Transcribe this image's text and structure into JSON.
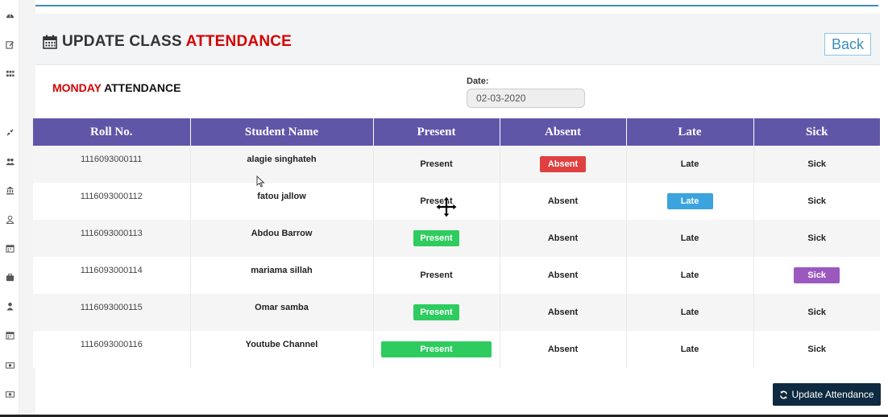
{
  "sidebar": {
    "icons": [
      "dashboard-icon",
      "edit-icon",
      "grid-icon",
      "compress-icon",
      "users-icon",
      "institution-icon",
      "user-outline-icon",
      "calendar-icon",
      "briefcase-icon",
      "user-icon",
      "calendar-icon",
      "money-icon",
      "money-icon"
    ]
  },
  "header": {
    "title_main": "UPDATE CLASS",
    "title_accent": "ATTENDANCE",
    "back_label": "Back",
    "icon": "calendar-icon"
  },
  "attendance": {
    "day": "MONDAY",
    "title_rest": "ATTENDANCE",
    "date_label": "Date:",
    "date_value": "02-03-2020"
  },
  "table": {
    "columns": [
      "Roll No.",
      "Student Name",
      "Present",
      "Absent",
      "Late",
      "Sick"
    ],
    "rows": [
      {
        "roll": "1116093000111",
        "name": "alagie singhateh",
        "present": "Present",
        "absent": "Absent",
        "late": "Late",
        "sick": "Sick",
        "selected": "absent"
      },
      {
        "roll": "1116093000112",
        "name": "fatou jallow",
        "present": "Present",
        "absent": "Absent",
        "late": "Late",
        "sick": "Sick",
        "selected": "late"
      },
      {
        "roll": "1116093000113",
        "name": "Abdou Barrow",
        "present": "Present",
        "absent": "Absent",
        "late": "Late",
        "sick": "Sick",
        "selected": "present"
      },
      {
        "roll": "1116093000114",
        "name": "mariama sillah",
        "present": "Present",
        "absent": "Absent",
        "late": "Late",
        "sick": "Sick",
        "selected": "sick"
      },
      {
        "roll": "1116093000115",
        "name": "Omar samba",
        "present": "Present",
        "absent": "Absent",
        "late": "Late",
        "sick": "Sick",
        "selected": "present"
      },
      {
        "roll": "1116093000116",
        "name": "Youtube Channel",
        "present": "Present",
        "absent": "Absent",
        "late": "Late",
        "sick": "Sick",
        "selected": "present"
      }
    ]
  },
  "footer": {
    "update_label": "Update Attendance",
    "update_icon": "refresh-icon"
  },
  "colors": {
    "accent_red": "#d50000",
    "table_header": "#5f56a8",
    "present": "#2ecc5f",
    "absent": "#e04040",
    "late": "#3ba3de",
    "sick": "#9b59c0",
    "update_button": "#0e2a40",
    "link_blue": "#3c8dbc"
  }
}
